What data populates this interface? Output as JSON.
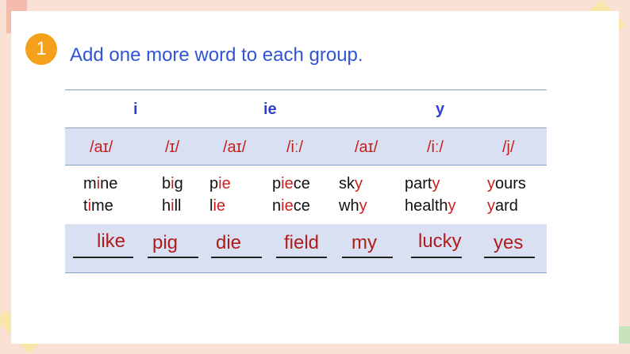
{
  "instruction": {
    "number": "1",
    "text": "Add one more word to each group."
  },
  "table": {
    "headers": [
      "i",
      "ie",
      "y"
    ],
    "phonetics": [
      "/aɪ/",
      "/ɪ/",
      "/aɪ/",
      "/iː/",
      "/aɪ/",
      "/iː/",
      "/j/"
    ],
    "columns": [
      {
        "words": [
          [
            "m",
            "i",
            "ne"
          ],
          [
            "t",
            "i",
            "me"
          ]
        ]
      },
      {
        "words": [
          [
            "b",
            "i",
            "g"
          ],
          [
            "h",
            "i",
            "ll"
          ]
        ]
      },
      {
        "words": [
          [
            "p",
            "ie",
            ""
          ],
          [
            "l",
            "ie",
            ""
          ]
        ]
      },
      {
        "words": [
          [
            "p",
            "ie",
            "ce"
          ],
          [
            "n",
            "ie",
            "ce"
          ]
        ]
      },
      {
        "words": [
          [
            "sk",
            "y",
            ""
          ],
          [
            "wh",
            "y",
            ""
          ]
        ]
      },
      {
        "words": [
          [
            "part",
            "y",
            ""
          ],
          [
            "health",
            "y",
            ""
          ]
        ]
      },
      {
        "words": [
          [
            "",
            "y",
            "ours"
          ],
          [
            "",
            "y",
            "ard"
          ]
        ]
      }
    ],
    "answers": [
      "like",
      "pig",
      "die",
      "field",
      "my",
      "lucky",
      "yes"
    ]
  },
  "colors": {
    "instruction": "#2f55d4",
    "header": "#2f3fd0",
    "highlight": "#c8201f",
    "answer": "#b01c1c",
    "badge": "#f5a01a",
    "band": "#d8e0f1"
  }
}
